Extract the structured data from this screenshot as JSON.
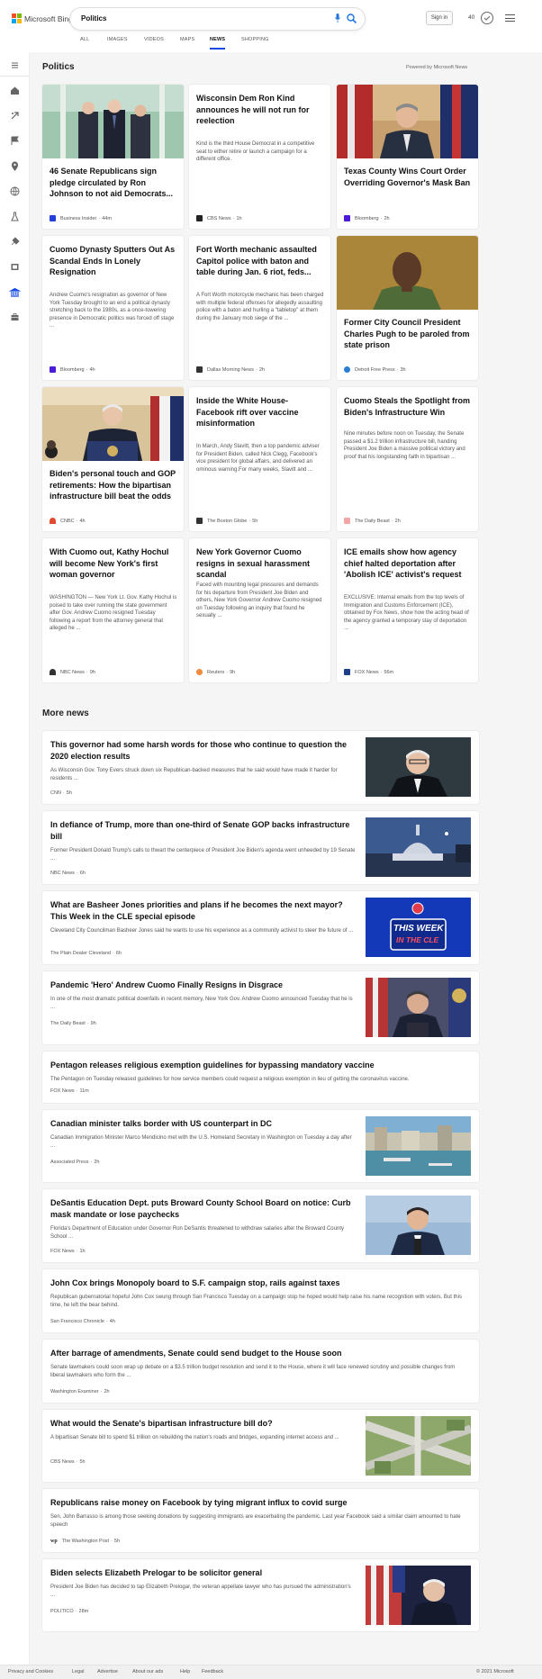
{
  "header": {
    "brand": "Microsoft Bing",
    "query": "Politics",
    "sign_in": "Sign in",
    "points": "40",
    "logo_colors": [
      "#f25022",
      "#7fba00",
      "#00a4ef",
      "#ffb900"
    ]
  },
  "tabs": [
    {
      "label": "ALL"
    },
    {
      "label": "IMAGES"
    },
    {
      "label": "VIDEOS"
    },
    {
      "label": "MAPS"
    },
    {
      "label": "NEWS",
      "active": true
    },
    {
      "label": "SHOPPING"
    }
  ],
  "sidebar": {
    "icons": [
      "menu-icon",
      "home-icon",
      "discover-icon",
      "sports-icon",
      "local-icon",
      "world-icon",
      "science-icon",
      "technology-icon",
      "entertainment-icon",
      "politics-icon",
      "business-icon"
    ]
  },
  "section": {
    "title": "Politics",
    "powered": "Powered by Microsoft News"
  },
  "cards": [
    {
      "title": "46 Senate Republicans sign pledge circulated by Ron Johnson to not aid Democrats...",
      "snippet": "",
      "source": "Business Insider",
      "time": "44m",
      "logo_color": "#2340d8"
    },
    {
      "title": "Wisconsin Dem Ron Kind announces he will not run for reelection",
      "snippet": "Kind is the third House Democrat in a competitive seat to either retire or launch a campaign for a different office.",
      "source": "CBS News",
      "time": "1h",
      "logo_color": "#222222"
    },
    {
      "title": "Texas County Wins Court Order Overriding Governor's Mask Ban",
      "snippet": "",
      "source": "Bloomberg",
      "time": "2h",
      "logo_color": "#4b1bd8"
    },
    {
      "title": "Cuomo Dynasty Sputters Out As Scandal Ends In Lonely Resignation",
      "snippet": "Andrew Cuomo's resignation as governor of New York Tuesday brought to an end a political dynasty stretching back to the 1980s, as a once-towering presence in Democratic politics was forced off stage ...",
      "source": "Bloomberg",
      "time": "4h",
      "logo_color": "#4b1bd8"
    },
    {
      "title": "Fort Worth mechanic assaulted Capitol police with baton and table during Jan. 6 riot, feds...",
      "snippet": "A Fort Worth motorcycle mechanic has been charged with multiple federal offenses for allegedly assaulting police with a baton and hurling a \"tabletop\" at them during the January mob siege of the ...",
      "source": "Dallas Morning News",
      "time": "2h",
      "logo_color": "#333333"
    },
    {
      "title": "Former City Council President Charles Pugh to be paroled from state prison",
      "snippet": "",
      "source": "Detroit Free Press",
      "time": "3h",
      "logo_color": "#2a7fd4"
    },
    {
      "title": "Biden's personal touch and GOP retirements: How the bipartisan infrastructure bill beat the odds",
      "snippet": "",
      "source": "CNBC",
      "time": "4h",
      "logo_color": "#e04a2f"
    },
    {
      "title": "Inside the White House-Facebook rift over vaccine misinformation",
      "snippet": "In March, Andy Slavitt, then a top pandemic adviser for President Biden, called Nick Clegg, Facebook's vice president for global affairs, and delivered an ominous warning.For many weeks, Slavitt and ...",
      "source": "The Boston Globe",
      "time": "5h",
      "logo_color": "#333333"
    },
    {
      "title": "Cuomo Steals the Spotlight from Biden's Infrastructure Win",
      "snippet": "Nine minutes before noon on Tuesday, the Senate passed a $1.2 trillion infrastructure bill, handing President Joe Biden a massive political victory and proof that his longstanding faith in bipartisan ...",
      "source": "The Daily Beast",
      "time": "2h",
      "logo_color": "#f4a6a6"
    },
    {
      "title": "With Cuomo out, Kathy Hochul will become New York's first woman governor",
      "snippet": "WASHINGTON — New York Lt. Gov. Kathy Hochul is poised to take over running the state government after Gov. Andrew Cuomo resigned Tuesday following a report from the attorney general that alleged he ...",
      "source": "NBC News",
      "time": "9h",
      "logo_color": "#333333"
    },
    {
      "title": "New York Governor Cuomo resigns in sexual harassment scandal",
      "snippet": "Faced with mounting legal pressures and demands for his departure from President Joe Biden and others, New York Governor Andrew Cuomo resigned on Tuesday following an inquiry that found he sexually ...",
      "source": "Reuters",
      "time": "9h",
      "logo_color": "#f08a3c"
    },
    {
      "title": "ICE emails show how agency chief halted deportation after 'Abolish ICE' activist's request",
      "snippet": "EXCLUSIVE: Internal emails from the top levels of Immigration and Customs Enforcement (ICE), obtained by Fox News, show how the acting head of the agency granted a temporary stay of deportation ...",
      "source": "FOX News",
      "time": "56m",
      "logo_color": "#1c3f8c"
    }
  ],
  "more": {
    "title": "More news",
    "items": [
      {
        "title": "This governor had some harsh words for those who continue to question the 2020 election results",
        "snippet": "As Wisconsin Gov. Tony Evers struck down six Republican-backed measures that he said would have made it harder for residents ...",
        "source": "CNN",
        "time": "5h",
        "logo_color": "#cc0000"
      },
      {
        "title": "In defiance of Trump, more than one-third of Senate GOP backs infrastructure bill",
        "snippet": "Former President Donald Trump's calls to thwart the centerpiece of President Joe Biden's agenda went unheeded by 19 Senate ...",
        "source": "NBC News",
        "time": "6h",
        "logo_color": "#333333"
      },
      {
        "title": "What are Basheer Jones priorities and plans if he becomes the next mayor? This Week in the CLE special episode",
        "snippet": "Cleveland City Councilman Basheer Jones said he wants to use his experience as a community activist to steer the future of ...",
        "source": "The Plain Dealer Cleveland",
        "time": "6h",
        "logo_color": "#2b5fa8",
        "image_text_1": "THIS WEEK",
        "image_text_2": "IN THE CLE"
      },
      {
        "title": "Pandemic 'Hero' Andrew Cuomo Finally Resigns in Disgrace",
        "snippet": "In one of the most dramatic political downfalls in recent memory, New York Gov. Andrew Cuomo announced Tuesday that he is ...",
        "source": "The Daily Beast",
        "time": "9h",
        "logo_color": "#f4a6a6"
      },
      {
        "title": "Pentagon releases religious exemption guidelines for bypassing mandatory vaccine",
        "snippet": "The Pentagon on Tuesday released guidelines for how service members could request a religious exemption in lieu of getting the coronavirus vaccine.",
        "source": "FOX News",
        "time": "11m",
        "logo_color": "#1c3f8c"
      },
      {
        "title": "Canadian minister talks border with US counterpart in DC",
        "snippet": "Canadian Immigration Minister Marco Mendicino met with the U.S. Homeland Secretary in Washington on Tuesday a day after ...",
        "source": "Associated Press",
        "time": "2h",
        "logo_color": "#cc0000"
      },
      {
        "title": "DeSantis Education Dept. puts Broward County School Board on notice: Curb mask mandate or lose paychecks",
        "snippet": "Florida's Department of Education under Governor Ron DeSantis threatened to withdraw salaries after the Broward County School ...",
        "source": "FOX News",
        "time": "1h",
        "logo_color": "#1c3f8c"
      },
      {
        "title": "John Cox brings Monopoly board to S.F. campaign stop, rails against taxes",
        "snippet": "Republican gubernatorial hopeful John Cox swung through San Francisco Tuesday on a campaign stop he hoped would help raise his name recognition with voters. But this time, he left the bear behind.",
        "source": "San Francisco Chronicle",
        "time": "4h",
        "logo_color": "#222222"
      },
      {
        "title": "After barrage of amendments, Senate could send budget to the House soon",
        "snippet": "Senate lawmakers could soon wrap up debate on a $3.5 trillion budget resolution and send it to the House, where it will face renewed scrutiny and possible changes from liberal lawmakers who form the ...",
        "source": "Washington Examiner",
        "time": "2h",
        "logo_color": "#444444"
      },
      {
        "title": "What would the Senate's bipartisan infrastructure bill do?",
        "snippet": "A bipartisan Senate bill to spend $1 trillion on rebuilding the nation's roads and bridges, expanding internet access and ...",
        "source": "CBS News",
        "time": "5h",
        "logo_color": "#222222"
      },
      {
        "title": "Republicans raise money on Facebook by tying migrant influx to covid surge",
        "snippet": "Sen. John Barrasso is among those seeking donations by suggesting immigrants are exacerbating the pandemic. Last year Facebook said a similar claim amounted to hate speech",
        "source": "The Washington Post",
        "time": "5h",
        "logo_text": "wp",
        "logo_color": "#222222"
      },
      {
        "title": "Biden selects Elizabeth Prelogar to be solicitor general",
        "snippet": "President Joe Biden has decided to tap Elizabeth Prelogar, the veteran appellate lawyer who has pursued the administration's ...",
        "source": "POLITICO",
        "time": "28m",
        "logo_color": "#c8102e"
      }
    ]
  },
  "footer": {
    "privacy": "Privacy and Cookies",
    "legal": "Legal",
    "advertise": "Advertise",
    "about_ads": "About our ads",
    "help": "Help",
    "feedback": "Feedback",
    "copyright": "© 2021 Microsoft"
  }
}
